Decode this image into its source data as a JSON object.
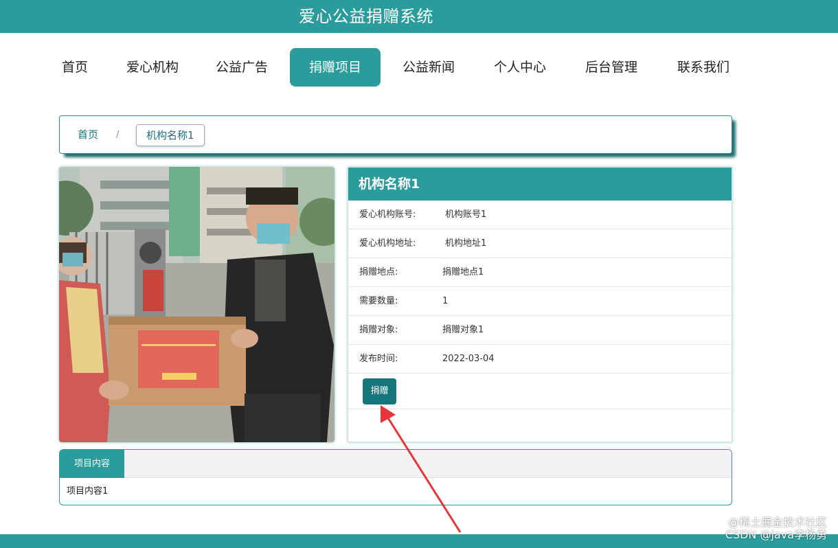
{
  "header": {
    "title": "爱心公益捐赠系统"
  },
  "nav": {
    "items": [
      {
        "label": "首页"
      },
      {
        "label": "爱心机构"
      },
      {
        "label": "公益广告"
      },
      {
        "label": "捐赠项目",
        "active": true
      },
      {
        "label": "公益新闻"
      },
      {
        "label": "个人中心"
      },
      {
        "label": "后台管理"
      },
      {
        "label": "联系我们"
      }
    ]
  },
  "breadcrumb": {
    "home": "首页",
    "separator": "/",
    "current": "机构名称1"
  },
  "detail": {
    "title": "机构名称1",
    "rows": [
      {
        "label": "爱心机构账号:",
        "value": "机构账号1"
      },
      {
        "label": "爱心机构地址:",
        "value": "机构地址1"
      },
      {
        "label": "捐赠地点:",
        "value": "捐赠地点1"
      },
      {
        "label": "需要数量:",
        "value": "1"
      },
      {
        "label": "捐赠对象:",
        "value": "捐赠对象1"
      },
      {
        "label": "发布时间:",
        "value": "2022-03-04"
      }
    ],
    "donate_label": "捐赠"
  },
  "tabs": {
    "active_label": "项目内容",
    "content": "项目内容1"
  },
  "watermark": {
    "line1": "@稀土掘金技术社区",
    "line2": "CSDN @java李杨勇"
  },
  "colors": {
    "primary": "#2b9c9c",
    "button": "#14757a",
    "arrow": "#e8353a"
  }
}
